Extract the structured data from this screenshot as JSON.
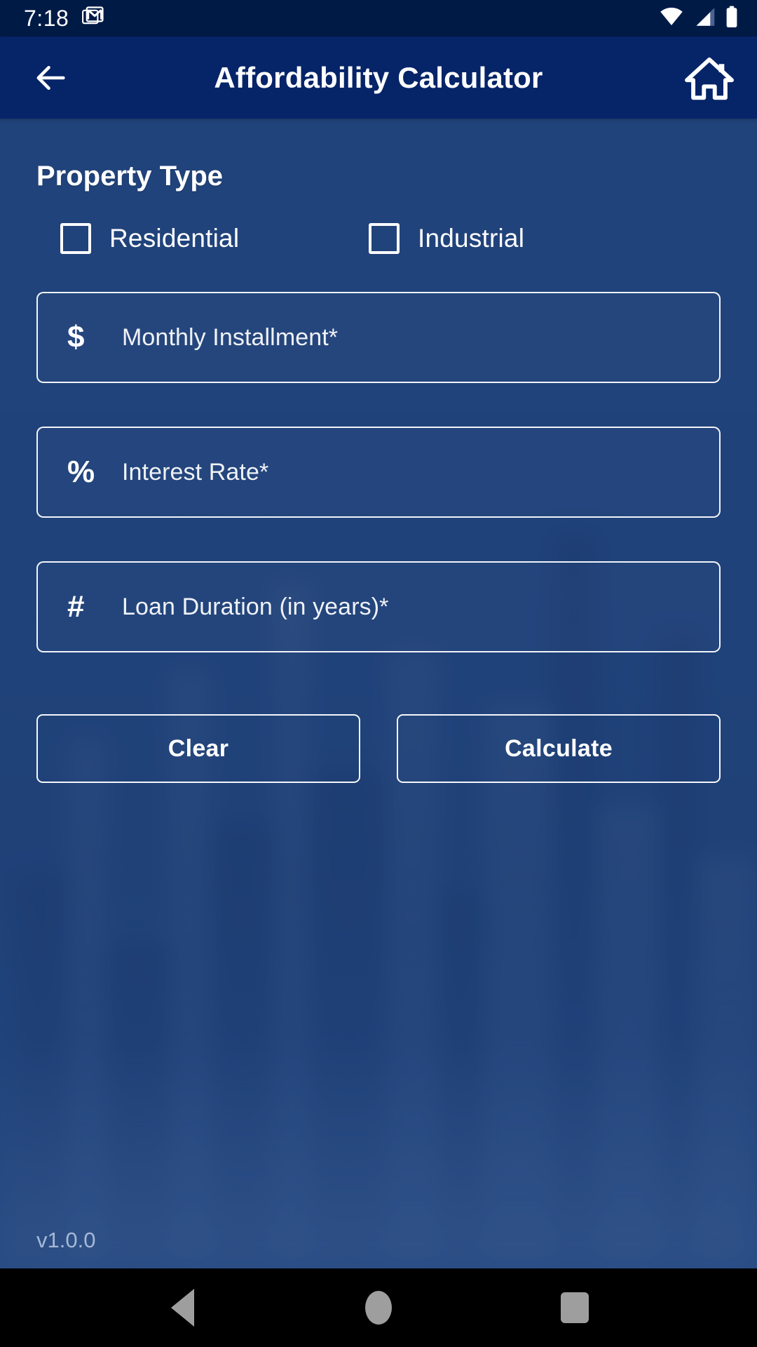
{
  "status_bar": {
    "clock": "7:18",
    "notification_icons": [
      "gmail-icon"
    ],
    "system_icons": [
      "wifi-icon",
      "cellular-signal-icon",
      "battery-icon"
    ],
    "background_color": "#001a46"
  },
  "app_bar": {
    "title": "Affordability Calculator",
    "back_icon": "arrow-left-icon",
    "home_icon": "home-icon",
    "background_color": "#062468"
  },
  "content": {
    "background_color": "#26477d",
    "property_type": {
      "title": "Property Type",
      "options": [
        {
          "label": "Residential",
          "checked": false
        },
        {
          "label": "Industrial",
          "checked": false
        }
      ]
    },
    "fields": [
      {
        "icon": "dollar-icon",
        "glyph": "$",
        "placeholder": "Monthly Installment*",
        "value": ""
      },
      {
        "icon": "percent-icon",
        "glyph": "%",
        "placeholder": "Interest Rate*",
        "value": ""
      },
      {
        "icon": "hash-icon",
        "glyph": "#",
        "placeholder": "Loan Duration (in years)*",
        "value": ""
      }
    ],
    "actions": {
      "clear_label": "Clear",
      "calculate_label": "Calculate"
    },
    "version": "v1.0.0"
  },
  "nav_bar": {
    "background_color": "#000000",
    "buttons": [
      {
        "name": "back",
        "icon": "triangle-back-icon"
      },
      {
        "name": "home",
        "icon": "circle-home-icon"
      },
      {
        "name": "recents",
        "icon": "square-recents-icon"
      }
    ]
  }
}
